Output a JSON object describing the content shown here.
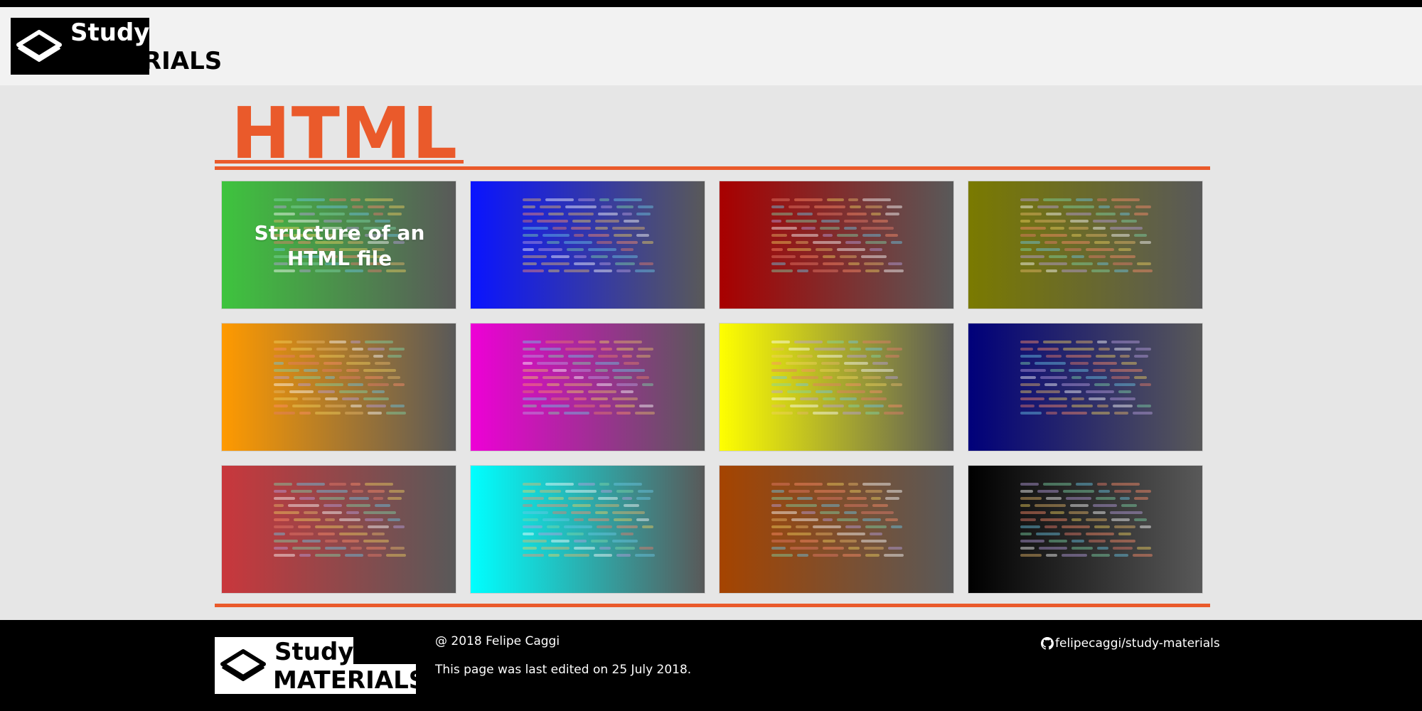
{
  "brand": {
    "line1": "Study",
    "line2": "MATERIALS"
  },
  "page": {
    "title": "HTML",
    "accent_color": "#ea5a2b"
  },
  "cards": [
    {
      "label": "Structure of an HTML file",
      "color": "#3ec43e"
    },
    {
      "label": "",
      "color": "#0a14ff"
    },
    {
      "label": "",
      "color": "#a80000"
    },
    {
      "label": "",
      "color": "#7a7a00"
    },
    {
      "label": "",
      "color": "#ff9a00"
    },
    {
      "label": "",
      "color": "#ee00d6"
    },
    {
      "label": "",
      "color": "#ffff00"
    },
    {
      "label": "",
      "color": "#00007a"
    },
    {
      "label": "",
      "color": "#c9373c"
    },
    {
      "label": "",
      "color": "#00ffff"
    },
    {
      "label": "",
      "color": "#a54400"
    },
    {
      "label": "",
      "color": "#000000"
    }
  ],
  "footer": {
    "copyright": "@ 2018 Felipe Caggi",
    "last_edited": "This page was last edited on 25 July 2018.",
    "repo": "felipecaggi/study-materials",
    "repo_icon": "github-icon"
  }
}
